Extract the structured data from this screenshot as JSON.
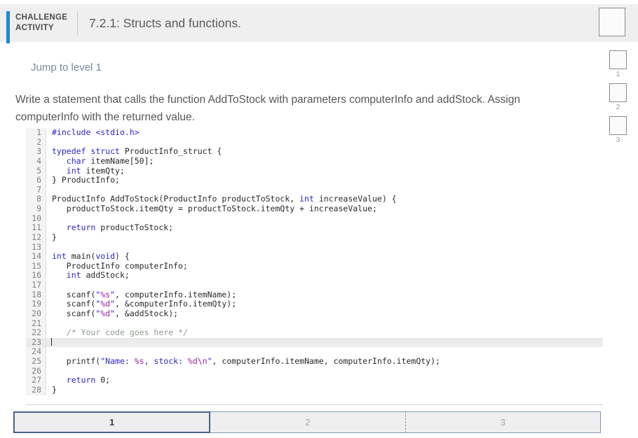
{
  "header": {
    "activity_label_line1": "CHALLENGE",
    "activity_label_line2": "ACTIVITY",
    "title": "7.2.1: Structs and functions.",
    "marker_icon": "pentagon-banner-icon"
  },
  "side_markers": [
    {
      "icon": "pentagon-banner-icon",
      "number": "1"
    },
    {
      "icon": "pentagon-banner-icon",
      "number": "2"
    },
    {
      "icon": "pentagon-banner-icon",
      "number": "3"
    }
  ],
  "body": {
    "jump_link": "Jump to level 1",
    "prompt": "Write a statement that calls the function AddToStock with parameters computerInfo and addStock. Assign computerInfo with the returned value."
  },
  "code": {
    "language": "c",
    "highlighted_line": 23,
    "cursor_line": 23,
    "lines": [
      {
        "n": "1",
        "text": "#include <stdio.h>"
      },
      {
        "n": "2",
        "text": ""
      },
      {
        "n": "3",
        "text": "typedef struct ProductInfo_struct {"
      },
      {
        "n": "4",
        "text": "   char itemName[50];"
      },
      {
        "n": "5",
        "text": "   int itemQty;"
      },
      {
        "n": "6",
        "text": "} ProductInfo;"
      },
      {
        "n": "7",
        "text": ""
      },
      {
        "n": "8",
        "text": "ProductInfo AddToStock(ProductInfo productToStock, int increaseValue) {"
      },
      {
        "n": "9",
        "text": "   productToStock.itemQty = productToStock.itemQty + increaseValue;"
      },
      {
        "n": "10",
        "text": ""
      },
      {
        "n": "11",
        "text": "   return productToStock;"
      },
      {
        "n": "12",
        "text": "}"
      },
      {
        "n": "13",
        "text": ""
      },
      {
        "n": "14",
        "text": "int main(void) {"
      },
      {
        "n": "15",
        "text": "   ProductInfo computerInfo;"
      },
      {
        "n": "16",
        "text": "   int addStock;"
      },
      {
        "n": "17",
        "text": ""
      },
      {
        "n": "18",
        "text": "   scanf(\"%s\", computerInfo.itemName);"
      },
      {
        "n": "19",
        "text": "   scanf(\"%d\", &computerInfo.itemQty);"
      },
      {
        "n": "20",
        "text": "   scanf(\"%d\", &addStock);"
      },
      {
        "n": "21",
        "text": ""
      },
      {
        "n": "22",
        "text": "   /* Your code goes here */"
      },
      {
        "n": "23",
        "text": ""
      },
      {
        "n": "24",
        "text": ""
      },
      {
        "n": "25",
        "text": "   printf(\"Name: %s, stock: %d\\n\", computerInfo.itemName, computerInfo.itemQty);"
      },
      {
        "n": "26",
        "text": ""
      },
      {
        "n": "27",
        "text": "   return 0;"
      },
      {
        "n": "28",
        "text": "}"
      }
    ]
  },
  "tabs": [
    {
      "label": "1",
      "active": true
    },
    {
      "label": "2",
      "active": false
    },
    {
      "label": "3",
      "active": false
    }
  ],
  "colors": {
    "accent_blue": "#1a8ad4",
    "header_bg": "#efefef",
    "keyword": "#2b27c6",
    "string": "#2b27c6",
    "format_spec": "#a020a0",
    "comment": "#8f9a8f",
    "tab_active_border": "#4a6288",
    "line_highlight": "#ebebeb"
  }
}
